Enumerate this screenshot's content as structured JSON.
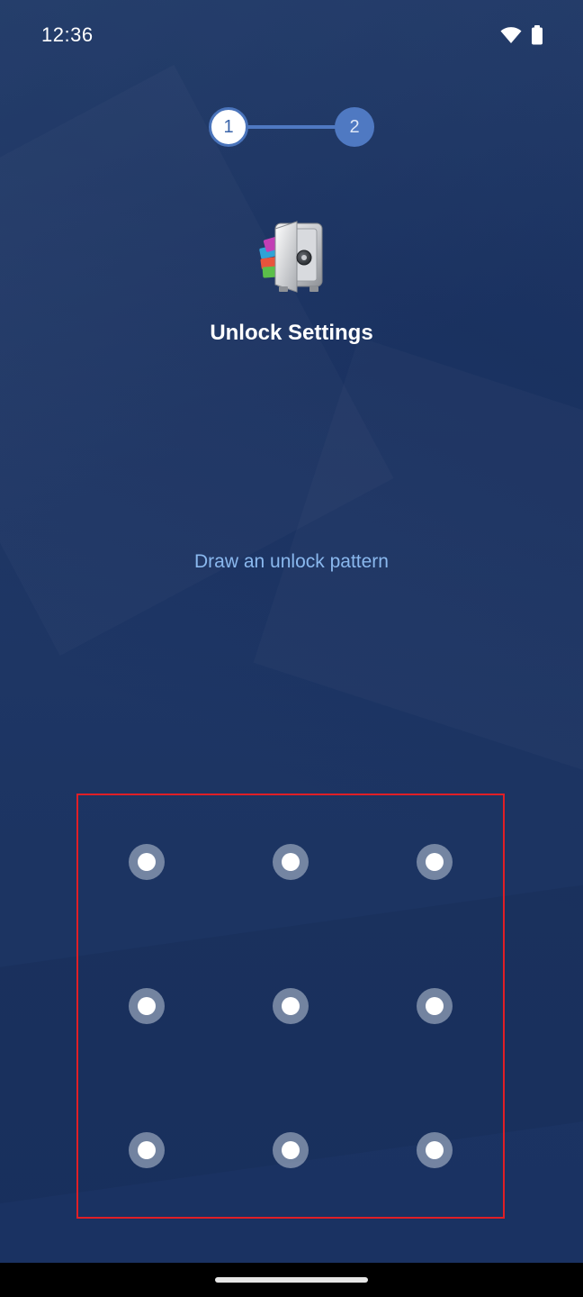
{
  "status_bar": {
    "time": "12:36",
    "icons": [
      "wifi-icon",
      "battery-icon"
    ]
  },
  "stepper": {
    "steps": [
      {
        "label": "1",
        "state": "current"
      },
      {
        "label": "2",
        "state": "pending"
      }
    ]
  },
  "app": {
    "icon": "app-lock-vault-icon"
  },
  "title": "Unlock Settings",
  "hint": "Draw an unlock pattern",
  "pattern": {
    "rows": 3,
    "cols": 3,
    "dots": [
      1,
      2,
      3,
      4,
      5,
      6,
      7,
      8,
      9
    ]
  },
  "colors": {
    "background": "#1f3766",
    "accent": "#4f79c2",
    "hint_text": "#8ab8ee",
    "highlight_border": "#e01f26"
  }
}
